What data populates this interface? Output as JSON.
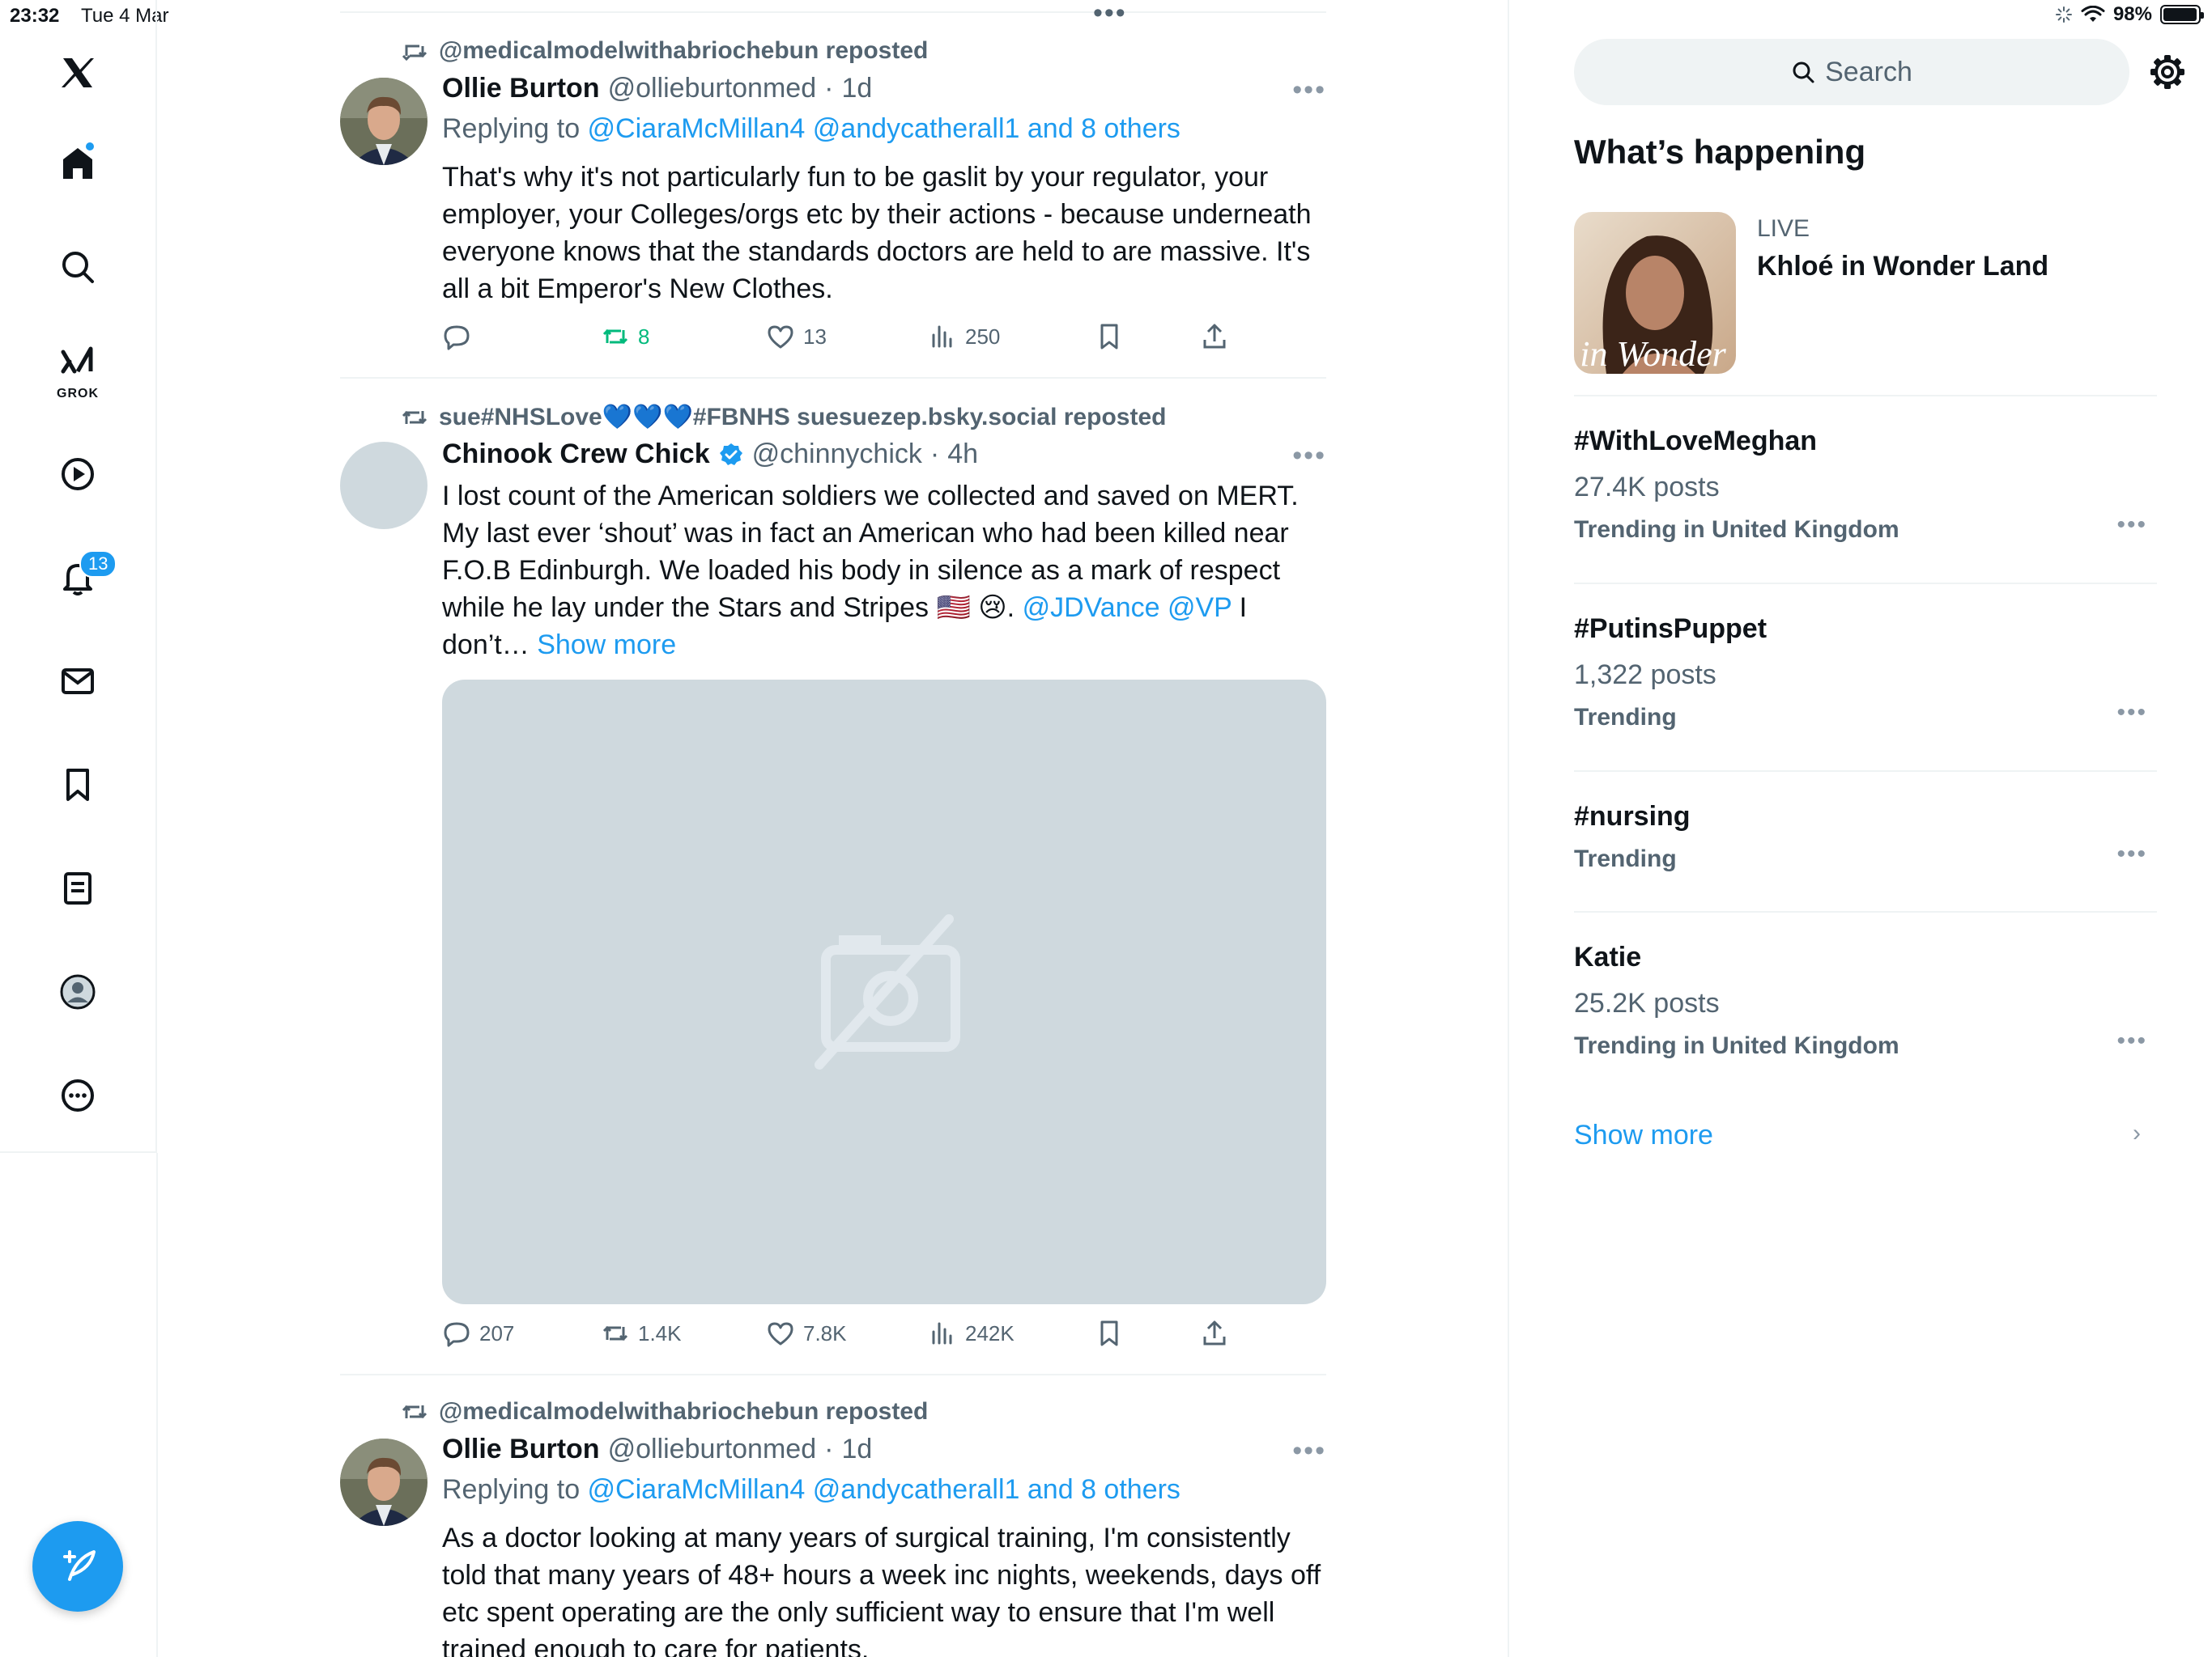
{
  "status_bar": {
    "time": "23:32",
    "date": "Tue 4 Mar",
    "battery": "98%",
    "battery_level": 0.98
  },
  "nav": {
    "items": [
      {
        "name": "x-logo-icon"
      },
      {
        "name": "home-icon"
      },
      {
        "name": "search-icon"
      },
      {
        "name": "grok-icon",
        "label": "GROK"
      },
      {
        "name": "video-icon"
      },
      {
        "name": "notifications-icon",
        "badge": "13"
      },
      {
        "name": "messages-icon"
      },
      {
        "name": "bookmarks-icon"
      },
      {
        "name": "lists-icon"
      },
      {
        "name": "profile-icon"
      },
      {
        "name": "more-icon"
      }
    ],
    "compose_icon": "compose-post-icon",
    "accent": "#1d9bf0"
  },
  "timeline": {
    "posts": [
      {
        "repost_by": "@medicalmodelwithabriochebun reposted",
        "author": "Ollie Burton",
        "handle": "@ollieburtonmed",
        "time": "1d",
        "replying_prefix": "Replying to ",
        "replying_targets": "@CiaraMcMillan4 @andycatherall1 and 8 others",
        "text": "That's why it's not particularly fun to be gaslit by your regulator, your employer, your Colleges/orgs etc by their actions - because underneath everyone knows that the standards doctors are held to are massive. It's all a bit Emperor's New Clothes.",
        "replies": "",
        "reposts": "8",
        "likes": "13",
        "views": "250"
      },
      {
        "repost_by": "sue#NHSLove💙💙💙#FBNHS suesuezep.bsky.social reposted",
        "author": "Chinook Crew Chick",
        "handle": "@chinnychick",
        "time": "4h",
        "text_main": "I lost count of the American soldiers we collected and saved on MERT. My last ever ‘shout’ was in fact an American who had been killed near F.O.B Edinburgh. We loaded his body in silence as a mark of respect while he lay under the Stars and Stripes 🇺🇸 😢. ",
        "mentions": "@JDVance @VP",
        "text_tail": " I don’t…",
        "show_more": "Show more",
        "replies": "207",
        "reposts": "1.4K",
        "likes": "7.8K",
        "views": "242K"
      },
      {
        "repost_by": "@medicalmodelwithabriochebun reposted",
        "author": "Ollie Burton",
        "handle": "@ollieburtonmed",
        "time": "1d",
        "replying_prefix": "Replying to ",
        "replying_targets": "@CiaraMcMillan4 @andycatherall1 and 8 others",
        "text": "As a doctor looking at many years of surgical training, I'm consistently told that many years of 48+ hours a week inc nights, weekends, days off etc spent operating are the only sufficient way to ensure that I'm well trained enough to care for patients."
      }
    ]
  },
  "sidebar": {
    "search_label": "Search",
    "heading": "What’s happening",
    "live": {
      "tag": "LIVE",
      "title": "Khloé in Wonder Land",
      "thumb_text": "é in Wonder L"
    },
    "trends": [
      {
        "name": "#WithLoveMeghan",
        "posts": "27.4K posts",
        "context": "Trending in United Kingdom"
      },
      {
        "name": "#PutinsPuppet",
        "posts": "1,322 posts",
        "context": "Trending"
      },
      {
        "name": "#nursing",
        "posts": "",
        "context": "Trending"
      },
      {
        "name": "Katie",
        "posts": "25.2K posts",
        "context": "Trending in United Kingdom"
      }
    ],
    "show_more": "Show more"
  }
}
